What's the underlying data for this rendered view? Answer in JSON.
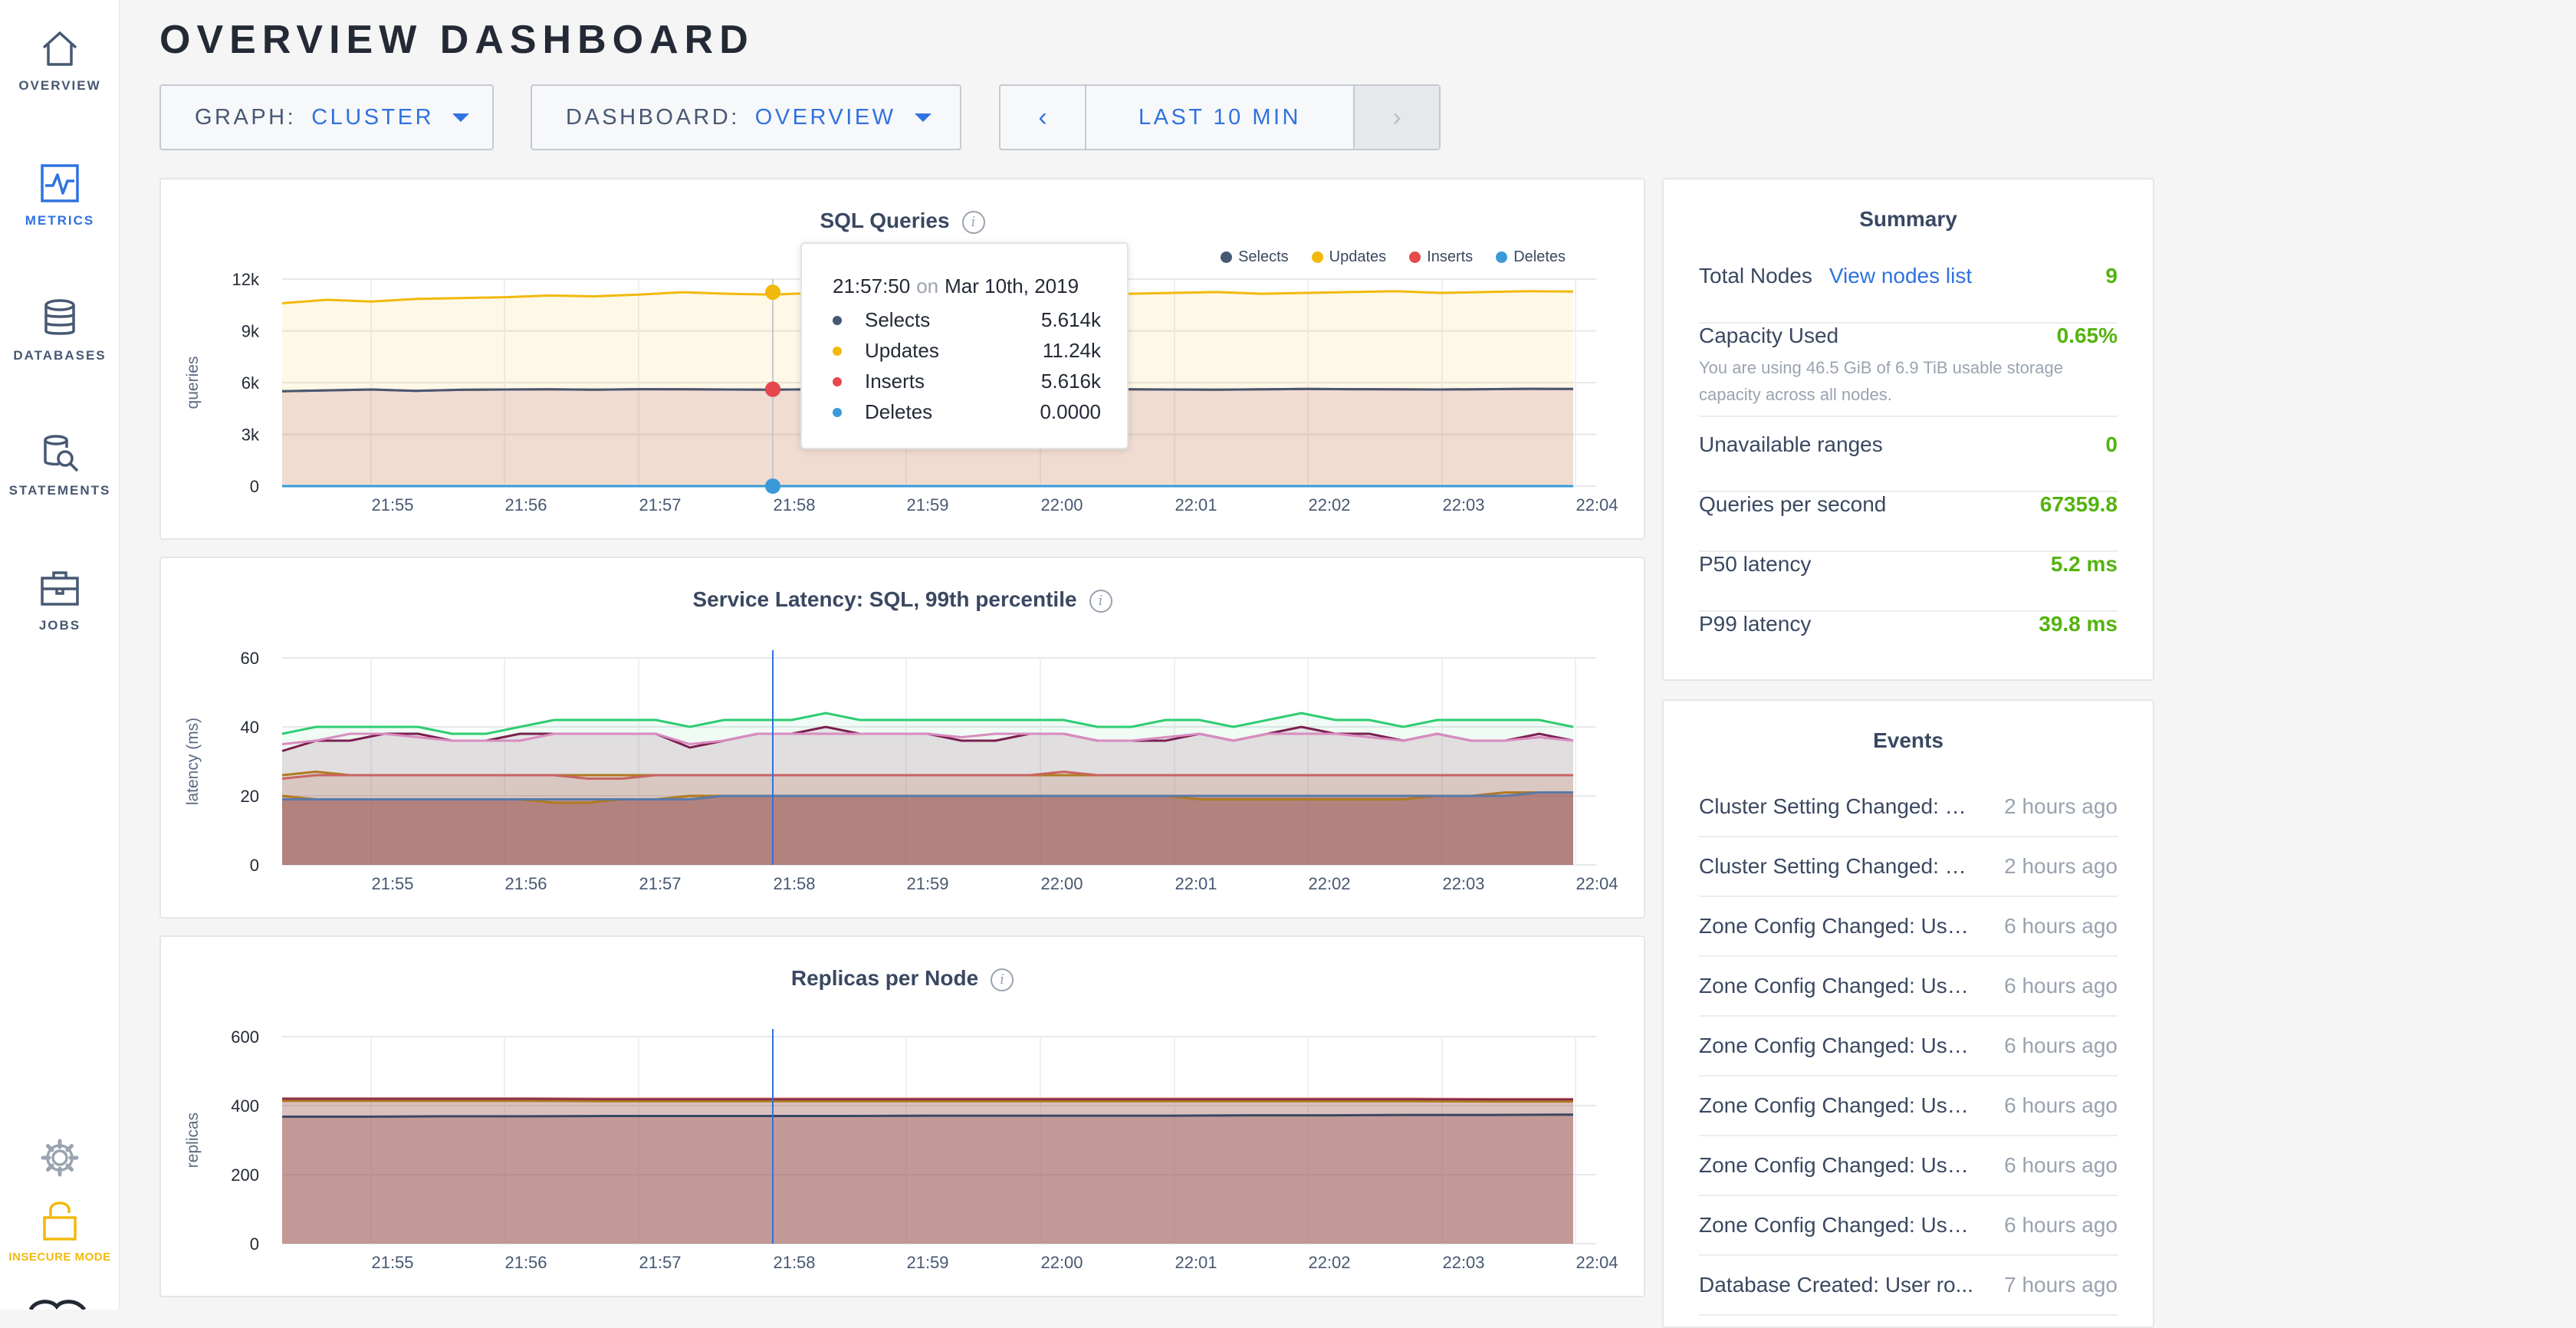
{
  "sidebar": {
    "items": [
      {
        "label": "OVERVIEW",
        "icon": "home-icon",
        "active": false
      },
      {
        "label": "METRICS",
        "icon": "metrics-icon",
        "active": true
      },
      {
        "label": "DATABASES",
        "icon": "database-icon",
        "active": false
      },
      {
        "label": "STATEMENTS",
        "icon": "statements-icon",
        "active": false
      },
      {
        "label": "JOBS",
        "icon": "jobs-icon",
        "active": false
      }
    ],
    "settings_icon": "gear-icon",
    "insecure_label": "INSECURE MODE",
    "insecure_icon": "lock-icon"
  },
  "header": {
    "title": "OVERVIEW DASHBOARD",
    "graph_label": "GRAPH:",
    "graph_value": "CLUSTER",
    "dashboard_label": "DASHBOARD:",
    "dashboard_value": "OVERVIEW",
    "time_range": "LAST 10 MIN",
    "prev_glyph": "‹",
    "next_glyph": "›"
  },
  "colors": {
    "accent": "#2f72e0",
    "selects": "#475872",
    "updates": "#f2b90c",
    "inserts": "#e5484d",
    "deletes": "#3a9ad9",
    "good": "#54b30e"
  },
  "tooltip": {
    "time": "21:57:50",
    "on": "on",
    "date": "Mar 10th, 2019",
    "rows": [
      {
        "name": "Selects",
        "value": "5.614k"
      },
      {
        "name": "Updates",
        "value": "11.24k"
      },
      {
        "name": "Inserts",
        "value": "5.616k"
      },
      {
        "name": "Deletes",
        "value": "0.0000"
      }
    ]
  },
  "chart_data": [
    {
      "type": "area",
      "title": "SQL Queries",
      "ylabel": "queries",
      "y_tick_labels": [
        "0",
        "3k",
        "6k",
        "9k",
        "12k"
      ],
      "ylim": [
        0,
        12000
      ],
      "x_tick_labels": [
        "21:55",
        "21:56",
        "21:57",
        "21:58",
        "21:59",
        "22:00",
        "22:01",
        "22:02",
        "22:03",
        "22:04"
      ],
      "legend": [
        "Selects",
        "Updates",
        "Inserts",
        "Deletes"
      ],
      "legend_position": "top-right",
      "series": [
        {
          "name": "Selects",
          "values": [
            5500,
            5550,
            5600,
            5520,
            5580,
            5600,
            5610,
            5590,
            5620,
            5614,
            5600,
            5590,
            5610,
            5620,
            5600,
            5580,
            5610,
            5600,
            5620,
            5610,
            5600,
            5590,
            5610,
            5630,
            5620,
            5610,
            5600,
            5620,
            5640,
            5630
          ]
        },
        {
          "name": "Updates",
          "values": [
            10600,
            10800,
            10700,
            10850,
            10900,
            10950,
            11050,
            11000,
            11100,
            11240,
            11150,
            11100,
            11200,
            11150,
            11100,
            11050,
            11200,
            11150,
            11100,
            11150,
            11200,
            11250,
            11150,
            11200,
            11250,
            11300,
            11200,
            11250,
            11300,
            11280
          ]
        },
        {
          "name": "Inserts",
          "values": [
            5500,
            5550,
            5600,
            5520,
            5580,
            5600,
            5610,
            5590,
            5620,
            5616,
            5600,
            5590,
            5610,
            5620,
            5600,
            5580,
            5610,
            5600,
            5620,
            5610,
            5600,
            5590,
            5610,
            5630,
            5620,
            5610,
            5600,
            5620,
            5640,
            5630
          ]
        },
        {
          "name": "Deletes",
          "values": [
            0,
            0,
            0,
            0,
            0,
            0,
            0,
            0,
            0,
            0,
            0,
            0,
            0,
            0,
            0,
            0,
            0,
            0,
            0,
            0,
            0,
            0,
            0,
            0,
            0,
            0,
            0,
            0,
            0,
            0
          ]
        }
      ]
    },
    {
      "type": "line",
      "title": "Service Latency: SQL, 99th percentile",
      "ylabel": "latency (ms)",
      "y_tick_labels": [
        "0",
        "20",
        "40",
        "60"
      ],
      "ylim": [
        0,
        60
      ],
      "x_tick_labels": [
        "21:55",
        "21:56",
        "21:57",
        "21:58",
        "21:59",
        "22:00",
        "22:01",
        "22:02",
        "22:03",
        "22:04"
      ],
      "series": [
        {
          "values": [
            38,
            40,
            40,
            40,
            40,
            38,
            38,
            40,
            42,
            42,
            42,
            42,
            40,
            42,
            42,
            42,
            44,
            42,
            42,
            42,
            42,
            42,
            42,
            42,
            40,
            40,
            42,
            42,
            40,
            42,
            44,
            42,
            42,
            40,
            42,
            42,
            42,
            42,
            40
          ]
        },
        {
          "values": [
            33,
            36,
            36,
            38,
            38,
            36,
            36,
            38,
            38,
            38,
            38,
            38,
            34,
            36,
            38,
            38,
            40,
            38,
            38,
            38,
            36,
            36,
            38,
            38,
            36,
            36,
            36,
            38,
            36,
            38,
            40,
            38,
            38,
            36,
            38,
            36,
            36,
            38,
            36
          ]
        },
        {
          "values": [
            35,
            36,
            38,
            38,
            37,
            36,
            36,
            36,
            38,
            38,
            38,
            38,
            35,
            36,
            38,
            38,
            38,
            38,
            38,
            38,
            37,
            38,
            38,
            38,
            36,
            36,
            37,
            38,
            36,
            38,
            38,
            38,
            37,
            36,
            38,
            36,
            36,
            37,
            36
          ]
        },
        {
          "values": [
            26,
            27,
            26,
            26,
            26,
            26,
            26,
            26,
            26,
            26,
            26,
            26,
            26,
            26,
            26,
            26,
            26,
            26,
            26,
            26,
            26,
            26,
            26,
            26,
            26,
            26,
            26,
            26,
            26,
            26,
            26,
            26,
            26,
            26,
            26,
            26,
            26,
            26,
            26
          ]
        },
        {
          "values": [
            25,
            26,
            26,
            26,
            26,
            26,
            26,
            26,
            26,
            25,
            25,
            26,
            26,
            26,
            26,
            26,
            26,
            26,
            26,
            26,
            26,
            26,
            26,
            27,
            26,
            26,
            26,
            26,
            26,
            26,
            26,
            26,
            26,
            26,
            26,
            26,
            26,
            26,
            26
          ]
        },
        {
          "values": [
            20,
            19,
            19,
            19,
            19,
            19,
            19,
            19,
            18,
            18,
            19,
            19,
            20,
            20,
            20,
            20,
            20,
            20,
            20,
            20,
            20,
            20,
            20,
            20,
            20,
            20,
            20,
            19,
            19,
            19,
            19,
            19,
            19,
            19,
            20,
            20,
            21,
            21,
            21
          ]
        },
        {
          "values": [
            19,
            19,
            19,
            19,
            19,
            19,
            19,
            19,
            19,
            19,
            19,
            19,
            19,
            20,
            20,
            20,
            20,
            20,
            20,
            20,
            20,
            20,
            20,
            20,
            20,
            20,
            20,
            20,
            20,
            20,
            20,
            20,
            20,
            20,
            20,
            20,
            20,
            21,
            21
          ]
        }
      ]
    },
    {
      "type": "area",
      "title": "Replicas per Node",
      "ylabel": "replicas",
      "y_tick_labels": [
        "0",
        "200",
        "400",
        "600"
      ],
      "ylim": [
        0,
        600
      ],
      "x_tick_labels": [
        "21:55",
        "21:56",
        "21:57",
        "21:58",
        "21:59",
        "22:00",
        "22:01",
        "22:02",
        "22:03",
        "22:04"
      ],
      "series": [
        {
          "values": [
            421,
            421,
            421,
            421,
            420,
            420,
            420,
            420,
            420,
            420,
            420,
            420,
            420,
            420,
            420,
            419,
            419
          ]
        },
        {
          "values": [
            418,
            418,
            418,
            418,
            417,
            417,
            417,
            417,
            417,
            417,
            417,
            417,
            417,
            417,
            417,
            416,
            416
          ]
        },
        {
          "values": [
            414,
            414,
            414,
            414,
            413,
            413,
            413,
            413,
            413,
            413,
            413,
            413,
            413,
            413,
            413,
            412,
            412
          ]
        },
        {
          "values": [
            368,
            368,
            369,
            369,
            370,
            370,
            370,
            370,
            371,
            371,
            371,
            371,
            372,
            372,
            373,
            373,
            374
          ]
        }
      ]
    }
  ],
  "summary": {
    "title": "Summary",
    "total_nodes_label": "Total Nodes",
    "total_nodes_link": "View nodes list",
    "total_nodes_value": "9",
    "capacity_label": "Capacity Used",
    "capacity_value": "0.65%",
    "capacity_note": "You are using 46.5 GiB of 6.9 TiB usable storage capacity across all nodes.",
    "unavailable_label": "Unavailable ranges",
    "unavailable_value": "0",
    "qps_label": "Queries per second",
    "qps_value": "67359.8",
    "p50_label": "P50 latency",
    "p50_value": "5.2 ms",
    "p99_label": "P99 latency",
    "p99_value": "39.8 ms"
  },
  "events": {
    "title": "Events",
    "items": [
      {
        "text": "Cluster Setting Changed: U...",
        "ago": "2 hours ago"
      },
      {
        "text": "Cluster Setting Changed: U...",
        "ago": "2 hours ago"
      },
      {
        "text": "Zone Config Changed: User...",
        "ago": "6 hours ago"
      },
      {
        "text": "Zone Config Changed: User...",
        "ago": "6 hours ago"
      },
      {
        "text": "Zone Config Changed: User...",
        "ago": "6 hours ago"
      },
      {
        "text": "Zone Config Changed: User...",
        "ago": "6 hours ago"
      },
      {
        "text": "Zone Config Changed: User...",
        "ago": "6 hours ago"
      },
      {
        "text": "Zone Config Changed: User...",
        "ago": "6 hours ago"
      },
      {
        "text": "Database Created: User ro...",
        "ago": "7 hours ago"
      }
    ]
  }
}
